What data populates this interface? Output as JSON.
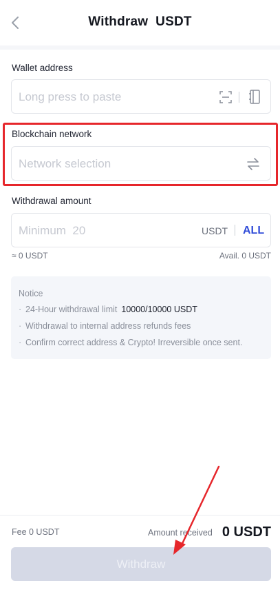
{
  "header": {
    "title": "Withdraw  USDT"
  },
  "wallet": {
    "label": "Wallet address",
    "placeholder": "Long press to paste"
  },
  "network": {
    "label": "Blockchain network",
    "placeholder": "Network selection"
  },
  "amount": {
    "label": "Withdrawal amount",
    "placeholder": "Minimum  20",
    "unit": "USDT",
    "all": "ALL",
    "approx": "≈ 0 USDT",
    "available": "Avail. 0 USDT"
  },
  "notice": {
    "title": "Notice",
    "limit_label": "24-Hour withdrawal limit",
    "limit_value": "10000/10000 USDT",
    "item2": "Withdrawal to internal address refunds fees",
    "item3": "Confirm correct address & Crypto! Irreversible once sent."
  },
  "footer": {
    "fee": "Fee 0 USDT",
    "amount_label": "Amount received",
    "amount_value": "0 USDT",
    "button": "Withdraw"
  },
  "colors": {
    "highlight": "#e6262b",
    "accent": "#2f4bd8",
    "button_disabled": "#d5d9e6"
  }
}
